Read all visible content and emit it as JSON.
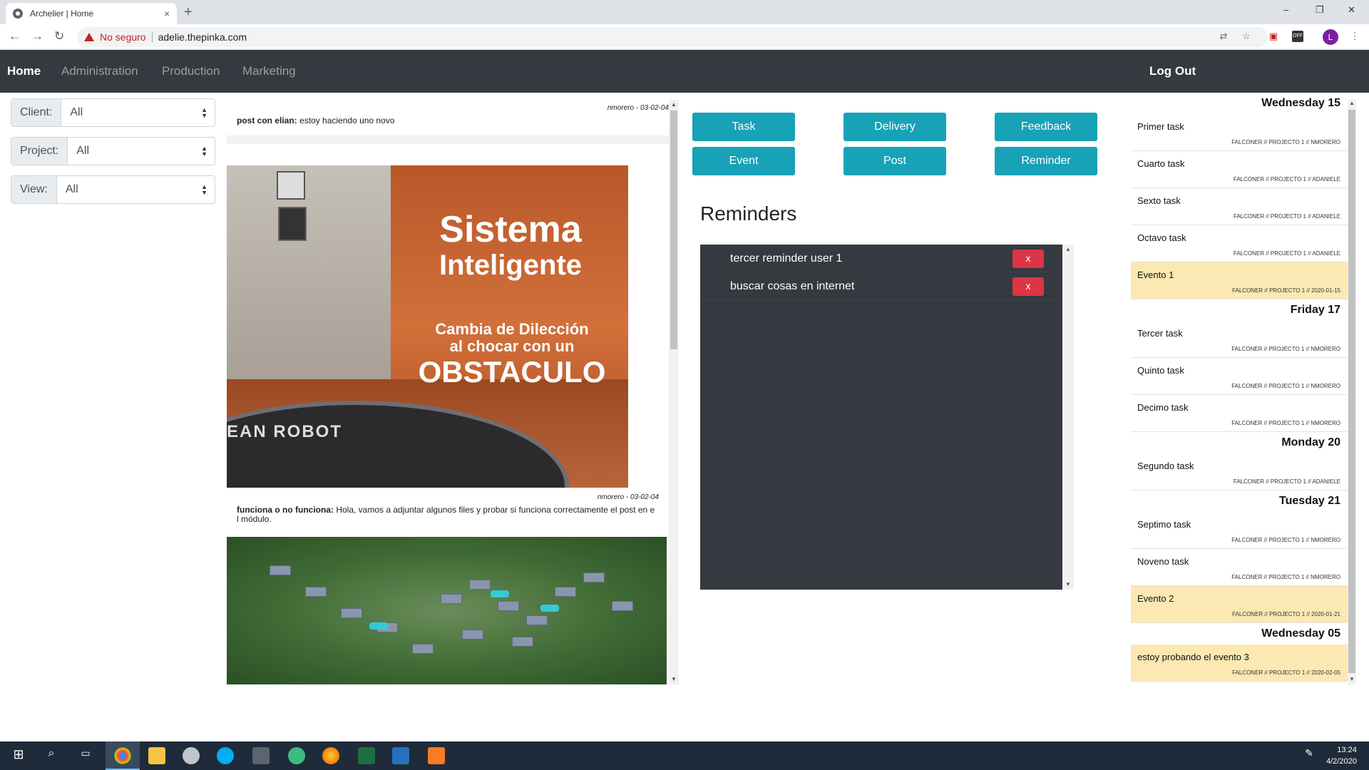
{
  "browser": {
    "tab_title": "Archelier | Home",
    "tab_close": "×",
    "new_tab": "+",
    "insecure_label": "No seguro",
    "url": "adelie.thepinka.com",
    "profile_initial": "L",
    "minimize": "–",
    "maximize": "❐",
    "close": "✕"
  },
  "navbar": {
    "items": [
      {
        "label": "Home",
        "active": true
      },
      {
        "label": "Administration",
        "active": false
      },
      {
        "label": "Production",
        "active": false
      },
      {
        "label": "Marketing",
        "active": false
      }
    ],
    "logout": "Log Out"
  },
  "filters": [
    {
      "label": "Client:",
      "value": "All"
    },
    {
      "label": "Project:",
      "value": "All"
    },
    {
      "label": "View:",
      "value": "All"
    }
  ],
  "posts": [
    {
      "meta": "nmorero - 03-02-04",
      "title": "post con elian:",
      "body": " estoy haciendo uno novo"
    },
    {
      "meta": "nmorero - 03-02-04",
      "title": "funciona o no funciona:",
      "body": " Hola, vamos a adjuntar algunos files y probar si funciona correctamente el post en e l módulo."
    }
  ],
  "robot_image": {
    "line1": "Sistema",
    "line2": "Inteligente",
    "line3": "Cambia de Dilección",
    "line4": "al chocar con un",
    "line5": "OBSTACULO",
    "brand": "EAN ROBOT"
  },
  "actions": {
    "task": "Task",
    "delivery": "Delivery",
    "feedback": "Feedback",
    "event": "Event",
    "post": "Post",
    "reminder": "Reminder"
  },
  "reminders": {
    "title": "Reminders",
    "items": [
      {
        "text": "tercer reminder user 1",
        "delete": "x"
      },
      {
        "text": "buscar cosas en internet",
        "delete": "x"
      }
    ]
  },
  "agenda": [
    {
      "day": "Wednesday 15",
      "items": [
        {
          "title": "Primer task",
          "meta": "FALCONER // PROJECTO 1 // NMORERO",
          "event": false
        },
        {
          "title": "Cuarto task",
          "meta": "FALCONER // PROJECTO 1 // ADANIELE",
          "event": false
        },
        {
          "title": "Sexto task",
          "meta": "FALCONER // PROJECTO 1 // ADANIELE",
          "event": false
        },
        {
          "title": "Octavo task",
          "meta": "FALCONER // PROJECTO 1 // ADANIELE",
          "event": false
        },
        {
          "title": "Evento 1",
          "meta": "FALCONER // PROJECTO 1 // 2020-01-15",
          "event": true
        }
      ]
    },
    {
      "day": "Friday 17",
      "items": [
        {
          "title": "Tercer task",
          "meta": "FALCONER // PROJECTO 1 // NMORERO",
          "event": false
        },
        {
          "title": "Quinto task",
          "meta": "FALCONER // PROJECTO 1 // NMORERO",
          "event": false
        },
        {
          "title": "Decimo task",
          "meta": "FALCONER // PROJECTO 1 // NMORERO",
          "event": false
        }
      ]
    },
    {
      "day": "Monday 20",
      "items": [
        {
          "title": "Segundo task",
          "meta": "FALCONER // PROJECTO 1 // ADANIELE",
          "event": false
        }
      ]
    },
    {
      "day": "Tuesday 21",
      "items": [
        {
          "title": "Septimo task",
          "meta": "FALCONER // PROJECTO 1 // NMORERO",
          "event": false
        },
        {
          "title": "Noveno task",
          "meta": "FALCONER // PROJECTO 1 // NMORERO",
          "event": false
        },
        {
          "title": "Evento 2",
          "meta": "FALCONER // PROJECTO 1 // 2020-01-21",
          "event": true
        }
      ]
    },
    {
      "day": "Wednesday 05",
      "items": [
        {
          "title": "estoy probando el evento 3",
          "meta": "FALCONER // PROJECTO 1 // 2020-02-05",
          "event": true
        }
      ]
    }
  ],
  "taskbar": {
    "time": "13:24",
    "date": "4/2/2020"
  },
  "colors": {
    "navbar": "#343a40",
    "action_button": "#17a2b8",
    "delete_button": "#dc3545",
    "event_highlight": "#fbe8b3"
  }
}
